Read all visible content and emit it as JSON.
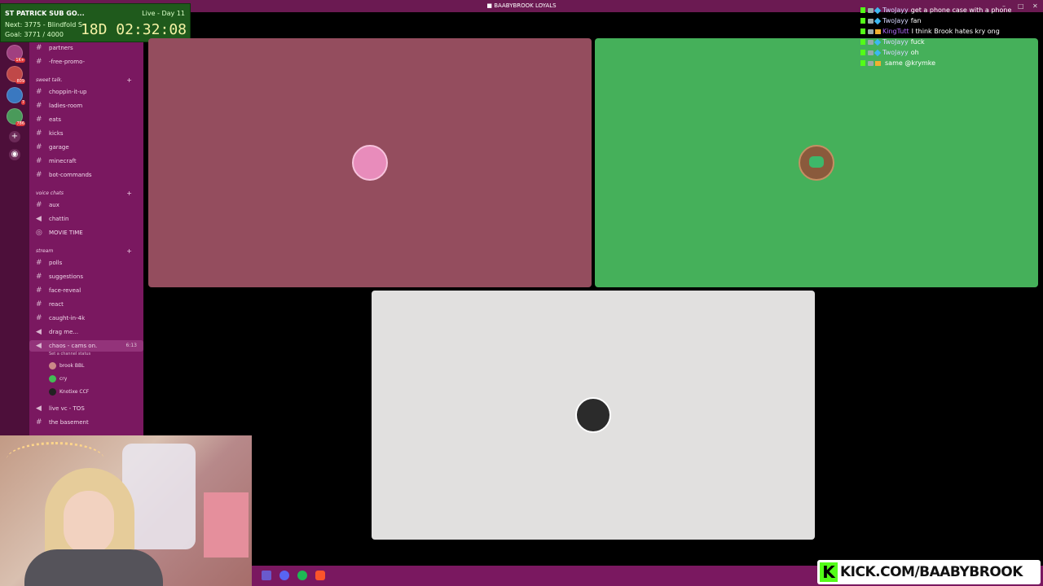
{
  "window": {
    "title": "BAABYBROOK LOYALS",
    "title_icon": "stream-icon",
    "controls": [
      "–",
      "□",
      "✕"
    ]
  },
  "sub_goal": {
    "title": "ST PATRICK SUB GO...",
    "live_day": "Live - Day 11",
    "next": "Next: 3775 - Blindfold S",
    "goal": "Goal: 3771 / 4000",
    "timer": "18D 02:32:08"
  },
  "server_rail": {
    "badges": [
      "1K+",
      "809",
      "7",
      "786"
    ],
    "add_server_icon": "plus-icon",
    "discover_icon": "compass-icon"
  },
  "sidebar": {
    "top_items": [
      {
        "name": "partners"
      },
      {
        "name": "-free-promo-"
      }
    ],
    "categories": {
      "sweet_talk": "sweet talk.",
      "voice_chats": "voice chats",
      "stream": "stream"
    },
    "sweet_talk_channels": [
      "choppin-it-up",
      "ladies-room",
      "eats",
      "kicks",
      "garage",
      "minecraft",
      "bot-commands"
    ],
    "voice_channels": [
      "aux",
      "chattin",
      "MOVIE TIME"
    ],
    "stream_channels": [
      "polls",
      "suggestions",
      "face-reveal",
      "react",
      "caught-in-4k",
      "drag me..."
    ],
    "active_channel": {
      "name": "chaos - cams on.",
      "time": "6:13",
      "status": "Set a channel status"
    },
    "voice_users": [
      {
        "name": "brook",
        "tag": "BBL"
      },
      {
        "name": "cry",
        "tag": ""
      },
      {
        "name": "Knotixe",
        "tag": "CCF"
      }
    ],
    "bottom_channels": [
      "live vc - TOS",
      "the basement"
    ]
  },
  "call_tiles": [
    {
      "bg": "#944d5e",
      "avatar_color": "#e88cbb"
    },
    {
      "bg": "#45b05a",
      "avatar_color": "#8a5a3c"
    },
    {
      "bg": "#e1e0df",
      "avatar_color": "#2b2b2b"
    }
  ],
  "chat": {
    "messages": [
      {
        "user": "TwoJayy",
        "text": "get a phone case with a phone",
        "badge": "gem"
      },
      {
        "user": "TwoJayy",
        "text": "fan",
        "badge": "gem"
      },
      {
        "user": "KingTutt",
        "text": "I think Brook hates kry ong",
        "badge": "crown",
        "user_color": "purple"
      },
      {
        "user": "TwoJayy",
        "text": "fuck",
        "badge": "gem"
      },
      {
        "user": "TwoJayy",
        "text": "oh",
        "badge": "gem"
      },
      {
        "user": "",
        "text": "same @krymke",
        "badge": "crown"
      }
    ]
  },
  "taskbar": {
    "icons": [
      "stream-app-icon",
      "discord-icon",
      "spotify-icon",
      "brave-icon"
    ]
  },
  "kick_banner": {
    "logo": "K",
    "text": "KICK.COM/BAABYBROOK"
  },
  "colors": {
    "sidebar": "#7a1860",
    "titlebar": "#6b1a52",
    "kick_green": "#53fc18"
  }
}
